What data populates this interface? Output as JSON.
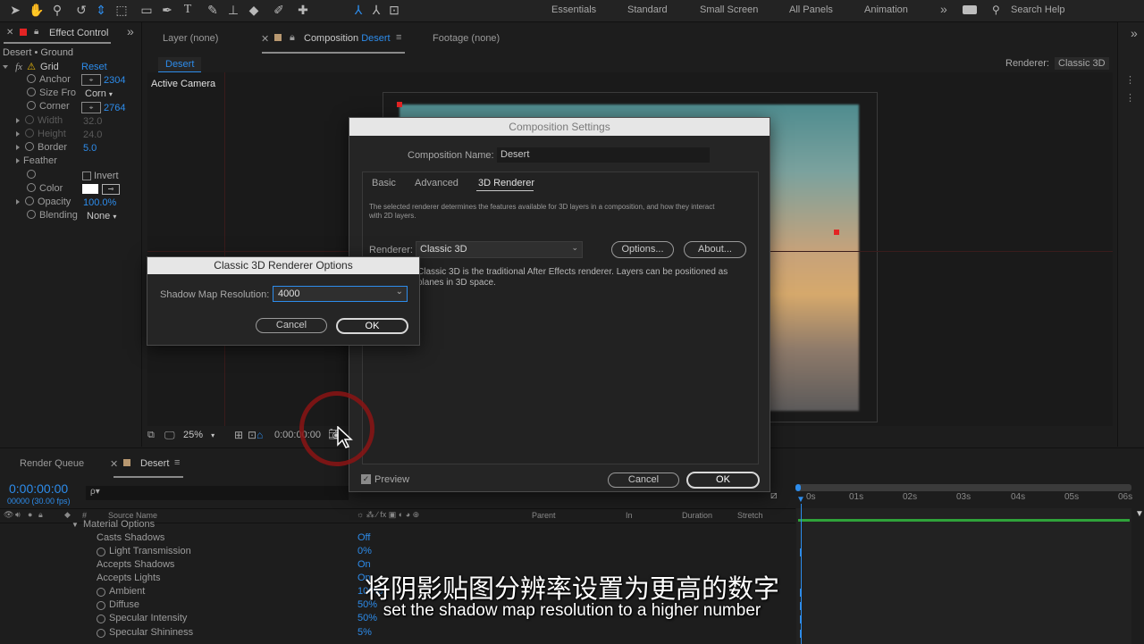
{
  "toolbar": {
    "workspaces": [
      "Essentials",
      "Standard",
      "Small Screen",
      "All Panels",
      "Animation"
    ],
    "search_placeholder": "Search Help",
    "more_glyph": "»"
  },
  "effect_controls": {
    "tab_label": "Effect Control",
    "breadcrumb": "Desert • Ground",
    "effect_name": "Grid",
    "reset_label": "Reset",
    "rows": [
      {
        "label": "Anchor",
        "value": "2304"
      },
      {
        "label": "Size Fro",
        "value": "Corn"
      },
      {
        "label": "Corner",
        "value": "2764"
      },
      {
        "label": "Width",
        "value": "32.0"
      },
      {
        "label": "Height",
        "value": "24.0"
      },
      {
        "label": "Border",
        "value": "5.0"
      },
      {
        "label": "Feather",
        "value": ""
      },
      {
        "label": "Invert",
        "value": ""
      },
      {
        "label": "Color",
        "value": ""
      },
      {
        "label": "Opacity",
        "value": "100.0%"
      },
      {
        "label": "Blending",
        "value": "None"
      }
    ]
  },
  "viewer": {
    "tab_layer": "Layer (none)",
    "tab_comp_prefix": "Composition",
    "tab_comp_name": "Desert",
    "tab_footage": "Footage (none)",
    "sub_tab": "Desert",
    "renderer_label": "Renderer:",
    "renderer_value": "Classic 3D",
    "active_camera": "Active Camera",
    "zoom": "25%",
    "timecode": "0:00:00:00"
  },
  "comp_settings": {
    "title": "Composition Settings",
    "name_label": "Composition Name:",
    "name_value": "Desert",
    "tabs": [
      "Basic",
      "Advanced",
      "3D Renderer"
    ],
    "description": "The selected renderer determines the features available for 3D layers in a composition, and how they interact with 2D layers.",
    "renderer_label": "Renderer:",
    "renderer_value": "Classic 3D",
    "options_button": "Options...",
    "about_button": "About...",
    "info": "Classic 3D is the traditional After Effects renderer. Layers can be positioned as planes in 3D space.",
    "preview_label": "Preview",
    "cancel_button": "Cancel",
    "ok_button": "OK"
  },
  "renderer_options": {
    "title": "Classic 3D Renderer Options",
    "shadow_label": "Shadow Map Resolution:",
    "shadow_value": "4000",
    "cancel_button": "Cancel",
    "ok_button": "OK"
  },
  "timeline": {
    "tab_render_queue": "Render Queue",
    "tab_comp": "Desert",
    "timecode": "0:00:00:00",
    "fps": "00000 (30.00 fps)",
    "search_placeholder": "ρ▾",
    "columns": {
      "source": "Source Name",
      "parent": "Parent",
      "in": "In",
      "duration": "Duration",
      "stretch": "Stretch",
      "number": "#"
    },
    "ruler": [
      "0s",
      "01s",
      "02s",
      "03s",
      "04s",
      "05s",
      "06s"
    ],
    "section": "Material Options",
    "rows": [
      {
        "label": "Casts Shadows",
        "value": "Off",
        "stopwatch": false
      },
      {
        "label": "Light Transmission",
        "value": "0%",
        "stopwatch": true
      },
      {
        "label": "Accepts Shadows",
        "value": "On",
        "stopwatch": false
      },
      {
        "label": "Accepts Lights",
        "value": "On",
        "stopwatch": false
      },
      {
        "label": "Ambient",
        "value": "100%",
        "stopwatch": true
      },
      {
        "label": "Diffuse",
        "value": "50%",
        "stopwatch": true
      },
      {
        "label": "Specular Intensity",
        "value": "50%",
        "stopwatch": true
      },
      {
        "label": "Specular Shininess",
        "value": "5%",
        "stopwatch": true
      }
    ]
  },
  "subtitles": {
    "zh": "将阴影贴图分辨率设置为更高的数字",
    "en": "set the shadow map resolution to a higher number"
  },
  "colors": {
    "accent": "#2d8ceb",
    "panel_bg": "#1d1d1d",
    "dialog_bg": "#252525",
    "cursor_ring": "#8b1414"
  }
}
